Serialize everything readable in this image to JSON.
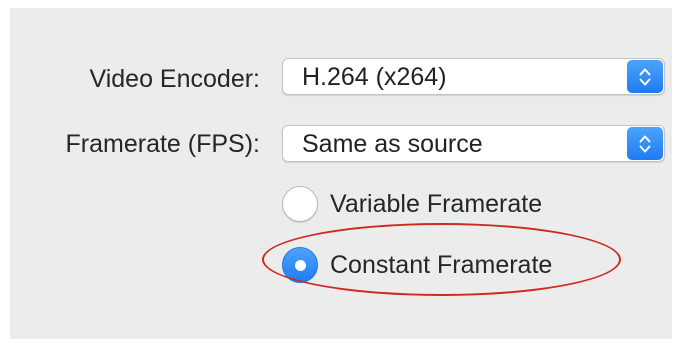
{
  "settings": {
    "video_encoder": {
      "label": "Video Encoder:",
      "value": "H.264 (x264)"
    },
    "framerate": {
      "label": "Framerate (FPS):",
      "value": "Same as source"
    },
    "framerate_mode": {
      "options": [
        {
          "label": "Variable Framerate",
          "selected": false
        },
        {
          "label": "Constant Framerate",
          "selected": true
        }
      ]
    }
  },
  "annotation": {
    "highlight_target": "Constant Framerate",
    "color": "#cc2a1e"
  },
  "colors": {
    "accent": "#2b8af6",
    "panel_background": "#ececec"
  },
  "icons": {
    "popup_stepper": "chevron-up-down-icon"
  }
}
